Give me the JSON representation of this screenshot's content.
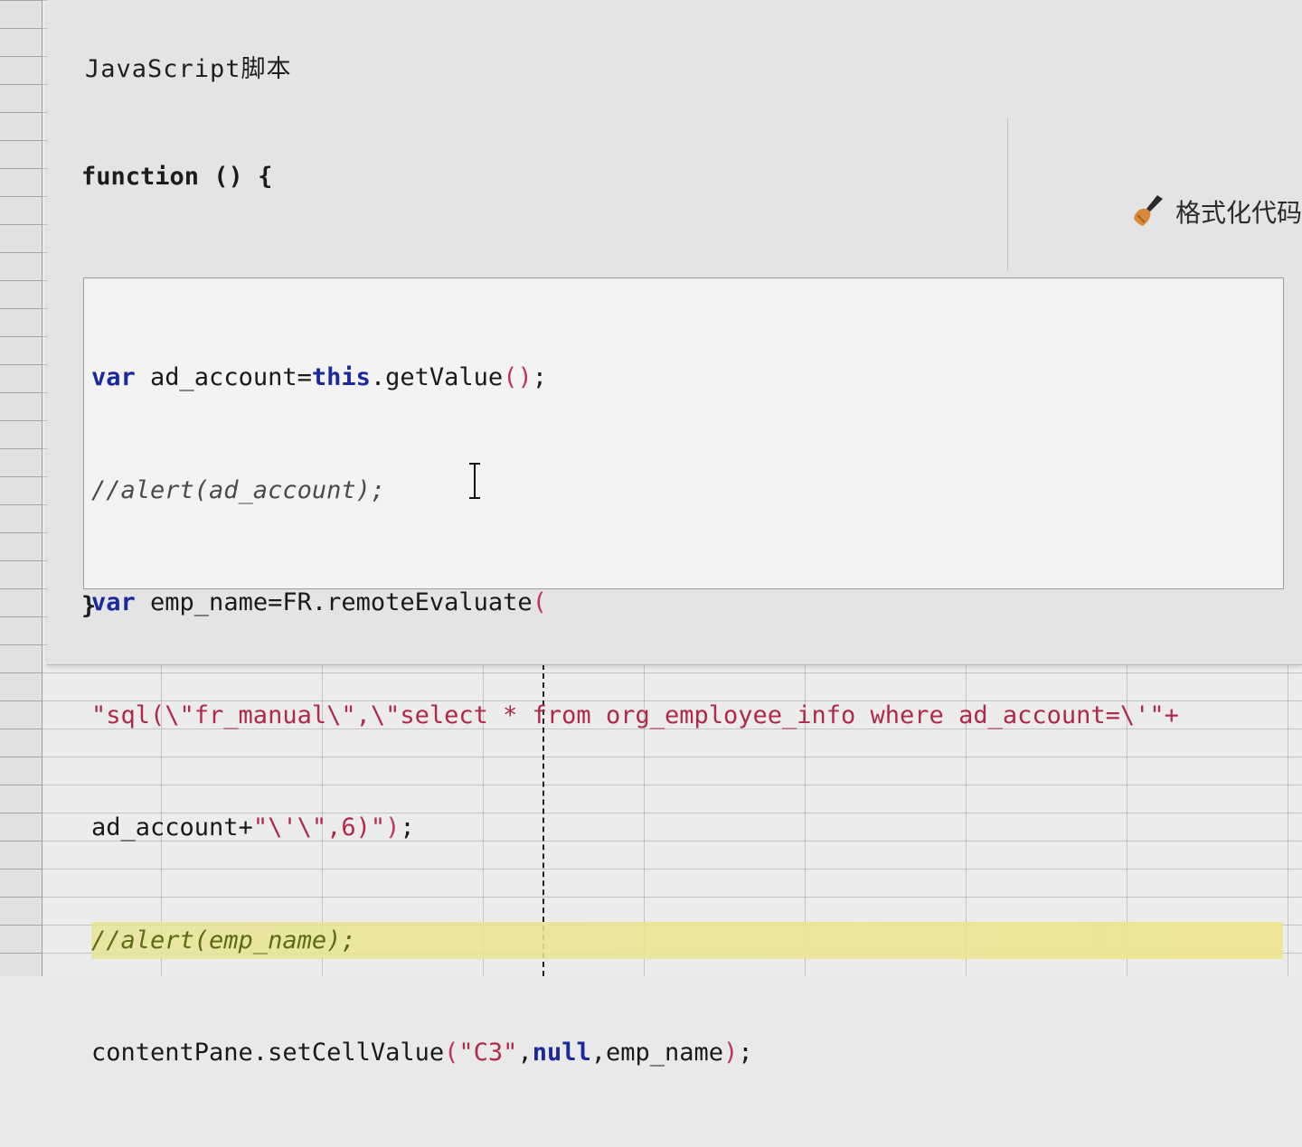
{
  "dialog": {
    "title": "JavaScript脚本",
    "function_header": "function () {",
    "function_close": "}",
    "format_button_label": "格式化代码"
  },
  "code": {
    "line1": {
      "kw_var": "var",
      "text_a": " ad_account=",
      "kw_this": "this",
      "text_b": ".getValue",
      "paren_a": "()",
      "text_c": ";"
    },
    "line2": {
      "comment": "//alert(ad_account);"
    },
    "line3": {
      "kw_var": "var",
      "text_a": " emp_name=FR.remoteEvaluate",
      "paren_a": "("
    },
    "line4": {
      "string": "\"sql(\\\"fr_manual\\\",\\\"select * from org_employee_info where ad_account=\\'\"+"
    },
    "line5": {
      "text_a": "ad_account+",
      "string": "\"\\'\\\",6)\"",
      "paren_a": ")",
      "text_b": ";"
    },
    "line6": {
      "comment": "//alert(emp_name);"
    },
    "line7": {
      "text_a": "contentPane.setCellValue",
      "paren_a": "(",
      "string": "\"C3\"",
      "text_b": ",",
      "kw_null": "null",
      "text_c": ",emp_name",
      "paren_b": ")",
      "text_d": ";"
    }
  },
  "colors": {
    "keyword": "#1a2a9c",
    "string": "#b0284a",
    "active_line": "#e8e496"
  },
  "icons": {
    "format": "broom-brush-icon",
    "cursor": "text-cursor-icon"
  }
}
